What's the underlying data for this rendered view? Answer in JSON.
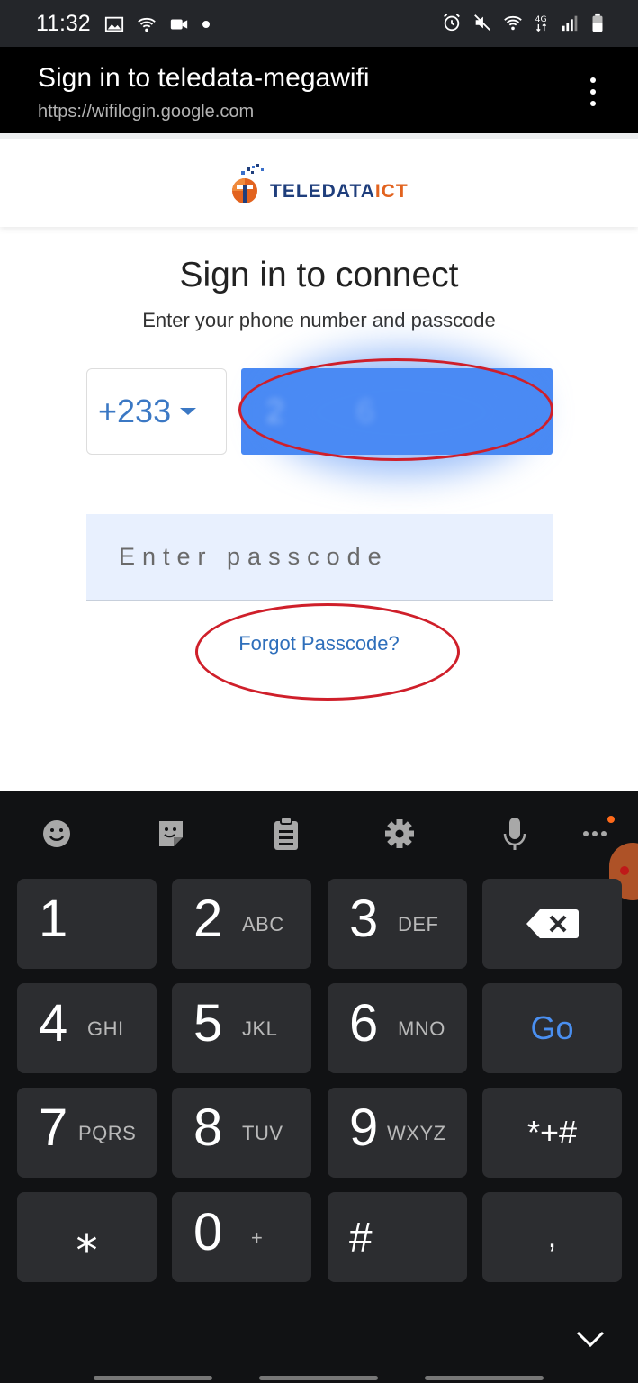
{
  "status_bar": {
    "time": "11:32",
    "left_icons": [
      "image-icon",
      "wifi-calling-icon",
      "video-icon",
      "dot-icon"
    ],
    "right_icons": [
      "alarm-icon",
      "mute-icon",
      "wifi-icon",
      "4g-signal-icon",
      "signal-bars-icon",
      "battery-icon"
    ],
    "network_label": "4G"
  },
  "browser_header": {
    "title": "Sign in to teledata-megawifi",
    "url": "https://wifilogin.google.com",
    "menu_icon": "more-vert-icon"
  },
  "brand": {
    "name_main": "TELEDATA",
    "name_accent": "ICT",
    "colors": {
      "primary": "#1f3e7c",
      "accent": "#e2631f"
    }
  },
  "signin": {
    "title": "Sign in to connect",
    "subtitle": "Enter your phone number and passcode",
    "country_code": "+233",
    "phone_value": "2        6",
    "passcode_placeholder": "Enter passcode",
    "forgot_link": "Forgot Passcode?"
  },
  "keyboard": {
    "toolbar": [
      "emoji-icon",
      "sticker-icon",
      "clipboard-icon",
      "settings-icon",
      "microphone-icon",
      "more-horiz-icon"
    ],
    "keys": {
      "k1": {
        "num": "1",
        "letters": ""
      },
      "k2": {
        "num": "2",
        "letters": "ABC"
      },
      "k3": {
        "num": "3",
        "letters": "DEF"
      },
      "k4": {
        "num": "4",
        "letters": "GHI"
      },
      "k5": {
        "num": "5",
        "letters": "JKL"
      },
      "k6": {
        "num": "6",
        "letters": "MNO"
      },
      "k7": {
        "num": "7",
        "letters": "PQRS"
      },
      "k8": {
        "num": "8",
        "letters": "TUV"
      },
      "k9": {
        "num": "9",
        "letters": "WXYZ"
      },
      "k0": {
        "num": "0",
        "letters": "+"
      },
      "star": "⁎",
      "hash": "#",
      "comma": ",",
      "symbols": "*+#",
      "go": "Go"
    },
    "accent": "#4a8ff0"
  }
}
